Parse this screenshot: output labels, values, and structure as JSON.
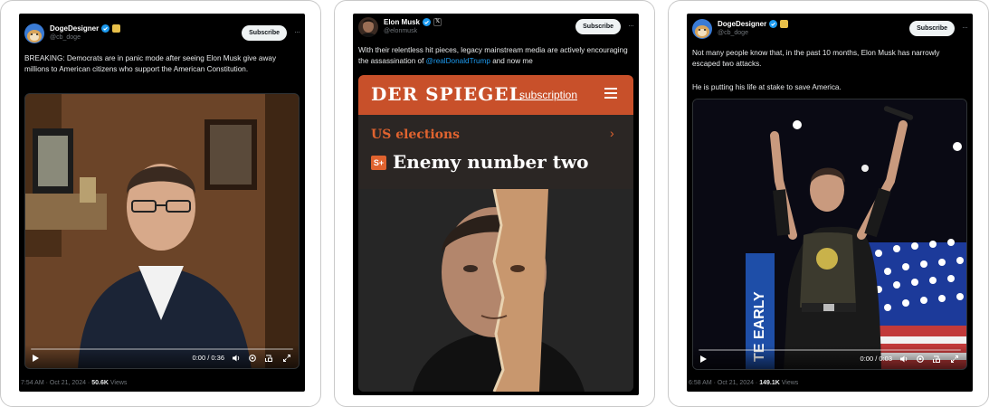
{
  "tweets": [
    {
      "name": "DogeDesigner",
      "handle": "@cb_doge",
      "subscribe": "Subscribe",
      "text": "BREAKING: Democrats are in panic mode after seeing Elon Musk give away millions to American citizens who support the American Constitution.",
      "video_time": "0:00 / 0:36",
      "meta_time": "7:54 AM · Oct 21, 2024 · ",
      "views": "50.6K",
      "views_label": " Views"
    },
    {
      "name": "Elon Musk",
      "handle": "@elonmusk",
      "subscribe": "Subscribe",
      "text_before": "With their relentless hit pieces, legacy mainstream media are actively encouraging the assassination of ",
      "mention": "@realDonaldTrump",
      "text_after": " and now me",
      "spiegel": {
        "logo": "DER SPIEGEL",
        "subscription": "subscription",
        "section": "US elections",
        "plus": "S+",
        "headline": "Enemy number two"
      }
    },
    {
      "name": "DogeDesigner",
      "handle": "@cb_doge",
      "subscribe": "Subscribe",
      "text1": "Not many people know that, in the past 10 months, Elon Musk has narrowly escaped two attacks.",
      "text2": "He is putting his life at stake to save America.",
      "banner_text": "TE EARLY",
      "video_time": "0:00 / 0:03",
      "meta_time": "6:58 AM · Oct 21, 2024 · ",
      "views": "149.1K",
      "views_label": " Views"
    }
  ],
  "colors": {
    "verified": "#1d9bf0",
    "spiegel_red": "#c8502a",
    "spiegel_dark": "#2b2624",
    "spiegel_orange": "#e0632f"
  },
  "icons": [
    "verified-icon",
    "play-icon",
    "volume-icon",
    "settings-icon",
    "pip-icon",
    "fullscreen-icon",
    "more-icon",
    "menu-icon",
    "chevron-right-icon"
  ]
}
